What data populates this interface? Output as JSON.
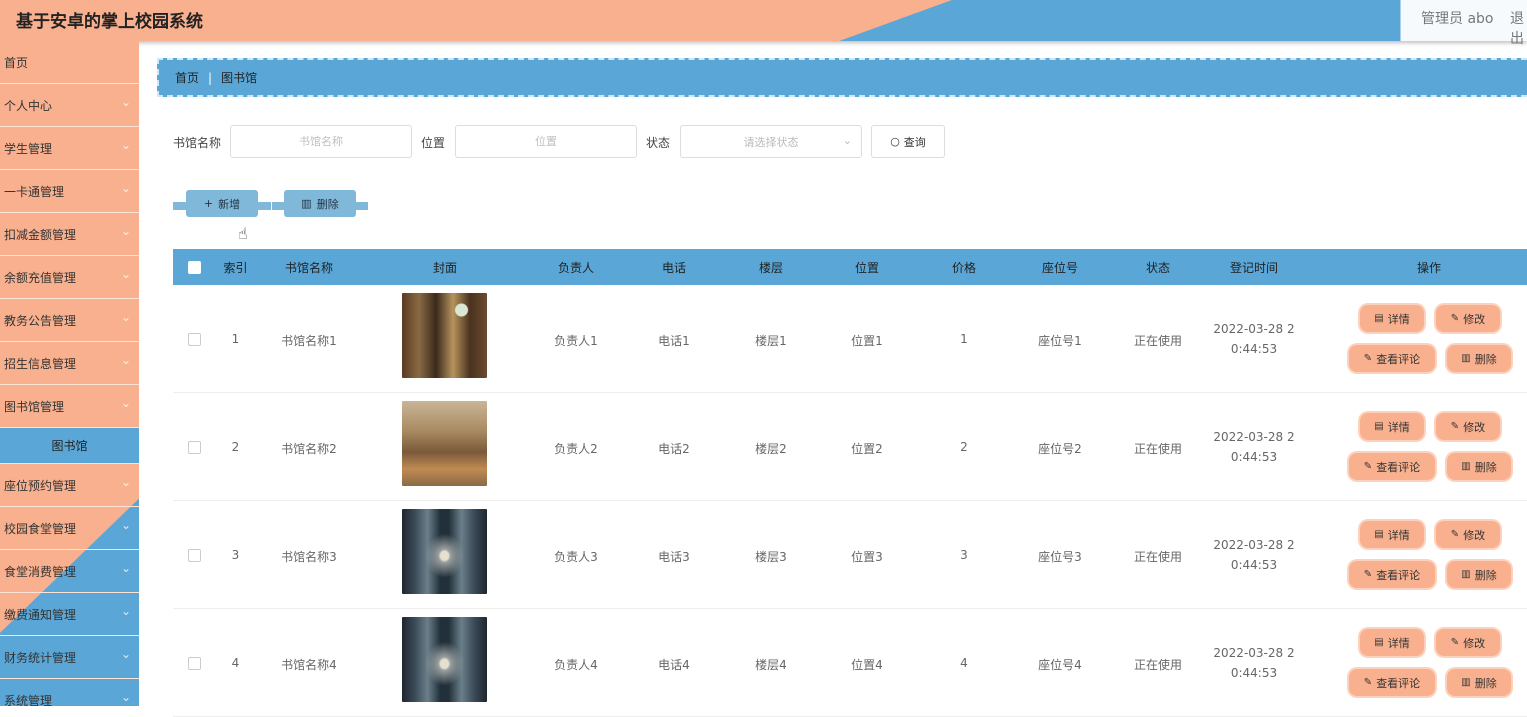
{
  "header": {
    "title": "基于安卓的掌上校园系统",
    "user": "管理员 abo",
    "logout": "退出"
  },
  "sidebar": {
    "items": [
      {
        "label": "首页",
        "chev": false
      },
      {
        "label": "个人中心",
        "chev": true
      },
      {
        "label": "学生管理",
        "chev": true
      },
      {
        "label": "一卡通管理",
        "chev": true
      },
      {
        "label": "扣减金额管理",
        "chev": true
      },
      {
        "label": "余额充值管理",
        "chev": true
      },
      {
        "label": "教务公告管理",
        "chev": true
      },
      {
        "label": "招生信息管理",
        "chev": true
      },
      {
        "label": "图书馆管理",
        "chev": true
      }
    ],
    "active_sub": "图书馆",
    "items2": [
      {
        "label": "座位预约管理"
      },
      {
        "label": "校园食堂管理"
      },
      {
        "label": "食堂消费管理"
      },
      {
        "label": "缴费通知管理"
      },
      {
        "label": "财务统计管理"
      },
      {
        "label": "系统管理"
      }
    ]
  },
  "breadcrumb": {
    "home": "首页",
    "current": "图书馆"
  },
  "search": {
    "name_label": "书馆名称",
    "name_placeholder": "书馆名称",
    "location_label": "位置",
    "location_placeholder": "位置",
    "status_label": "状态",
    "status_placeholder": "请选择状态",
    "query_label": "查询"
  },
  "actions": {
    "add_label": "新增",
    "delete_label": "删除"
  },
  "table": {
    "headers": [
      "索引",
      "书馆名称",
      "封面",
      "负责人",
      "电话",
      "楼层",
      "位置",
      "价格",
      "座位号",
      "状态",
      "登记时间",
      "操作"
    ],
    "rows": [
      {
        "index": "1",
        "name": "书馆名称1",
        "manager": "负责人1",
        "phone": "电话1",
        "floor": "楼层1",
        "location": "位置1",
        "price": "1",
        "seat": "座位号1",
        "status": "正在使用",
        "time1": "2022-03-28 2",
        "time2": "0:44:53"
      },
      {
        "index": "2",
        "name": "书馆名称2",
        "manager": "负责人2",
        "phone": "电话2",
        "floor": "楼层2",
        "location": "位置2",
        "price": "2",
        "seat": "座位号2",
        "status": "正在使用",
        "time1": "2022-03-28 2",
        "time2": "0:44:53"
      },
      {
        "index": "3",
        "name": "书馆名称3",
        "manager": "负责人3",
        "phone": "电话3",
        "floor": "楼层3",
        "location": "位置3",
        "price": "3",
        "seat": "座位号3",
        "status": "正在使用",
        "time1": "2022-03-28 2",
        "time2": "0:44:53"
      },
      {
        "index": "4",
        "name": "书馆名称4",
        "manager": "负责人4",
        "phone": "电话4",
        "floor": "楼层4",
        "location": "位置4",
        "price": "4",
        "seat": "座位号4",
        "status": "正在使用",
        "time1": "2022-03-28 2",
        "time2": "0:44:53"
      }
    ],
    "row_actions": {
      "detail": "详情",
      "edit": "修改",
      "comments": "查看评论",
      "delete": "删除"
    }
  },
  "colors": {
    "peach": "#f9b08e",
    "blue": "#5aa6d6",
    "button_blue": "#7fb8d9"
  }
}
